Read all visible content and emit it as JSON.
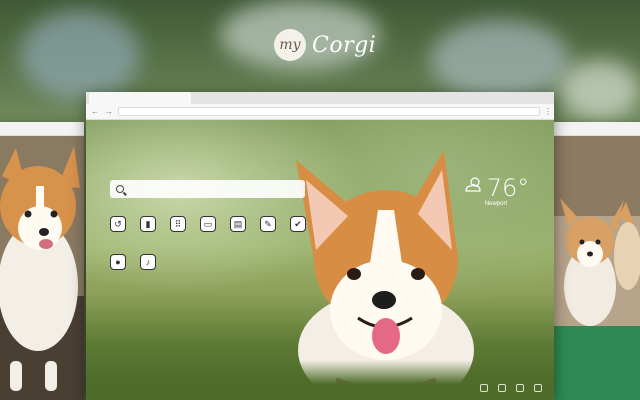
{
  "logo": {
    "badge": "my",
    "name": "Corgi"
  },
  "browser": {
    "nav_back": "←",
    "nav_forward": "→",
    "menu": "⋮"
  },
  "search": {
    "placeholder": ""
  },
  "apps": [
    {
      "name": "history-icon",
      "glyph": "↺"
    },
    {
      "name": "bookmark-icon",
      "glyph": "▮"
    },
    {
      "name": "apps-grid-icon",
      "glyph": "⠿"
    },
    {
      "name": "games-icon",
      "glyph": "▭"
    },
    {
      "name": "store-icon",
      "glyph": "▤"
    },
    {
      "name": "edit-icon",
      "glyph": "✎"
    },
    {
      "name": "check-icon",
      "glyph": "✔"
    },
    {
      "name": "chat-icon",
      "glyph": "●"
    },
    {
      "name": "music-icon",
      "glyph": "♪"
    }
  ],
  "weather": {
    "temperature": "76°",
    "city": "Newport",
    "icon": "partly-cloudy-icon"
  }
}
